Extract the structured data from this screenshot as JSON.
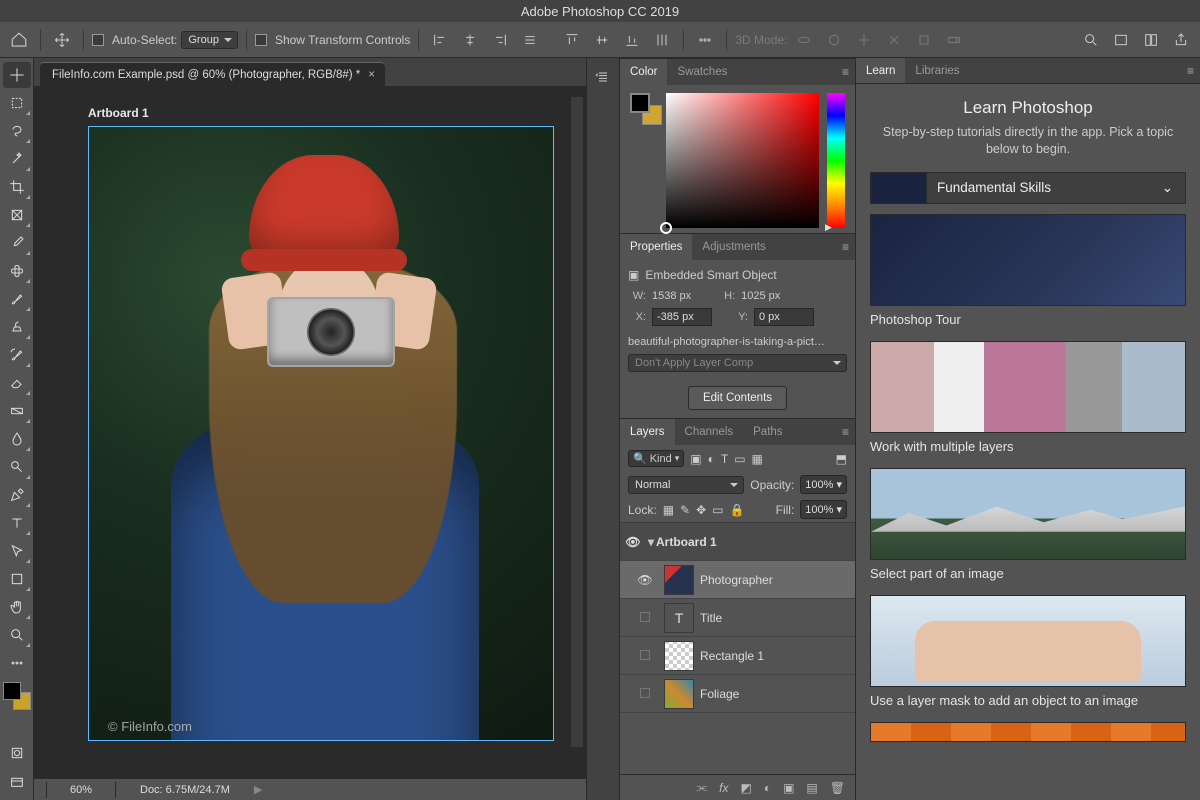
{
  "app_title": "Adobe Photoshop CC 2019",
  "options_bar": {
    "auto_select_label": "Auto-Select:",
    "auto_select_mode": "Group",
    "show_transform_label": "Show Transform Controls",
    "mode_label": "3D Mode:"
  },
  "document": {
    "tab_title": "FileInfo.com Example.psd @ 60% (Photographer, RGB/8#) *",
    "artboard_label": "Artboard 1",
    "watermark": "© FileInfo.com",
    "zoom": "60%",
    "doc_size": "Doc: 6.75M/24.7M"
  },
  "tools": [
    "move",
    "marquee",
    "lasso",
    "magic-wand",
    "crop",
    "frame",
    "eyedropper",
    "spot-heal",
    "brush",
    "clone-stamp",
    "history-brush",
    "eraser",
    "gradient",
    "blur",
    "dodge",
    "pen",
    "type",
    "path-select",
    "shape",
    "hand",
    "zoom"
  ],
  "color_panel": {
    "tabs": [
      "Color",
      "Swatches"
    ],
    "active": 0
  },
  "properties_panel": {
    "tabs": [
      "Properties",
      "Adjustments"
    ],
    "active": 0,
    "object_type": "Embedded Smart Object",
    "W": "1538 px",
    "H": "1025 px",
    "X": "-385 px",
    "Y": "0 px",
    "linked_name": "beautiful-photographer-is-taking-a-pict…",
    "layer_comp": "Don't Apply Layer Comp",
    "edit_btn": "Edit Contents"
  },
  "layers_panel": {
    "tabs": [
      "Layers",
      "Channels",
      "Paths"
    ],
    "active": 0,
    "filter_label": "Kind",
    "blend_mode": "Normal",
    "opacity_label": "Opacity:",
    "opacity": "100%",
    "lock_label": "Lock:",
    "fill_label": "Fill:",
    "fill": "100%",
    "layers": [
      {
        "name": "Artboard 1",
        "type": "artboard",
        "visible": true,
        "expanded": true
      },
      {
        "name": "Photographer",
        "type": "smartobject",
        "visible": true,
        "selected": true
      },
      {
        "name": "Title",
        "type": "text",
        "visible": false
      },
      {
        "name": "Rectangle 1",
        "type": "shape",
        "visible": false
      },
      {
        "name": "Foliage",
        "type": "image",
        "visible": false
      }
    ]
  },
  "learn_panel": {
    "tabs": [
      "Learn",
      "Libraries"
    ],
    "active": 0,
    "heading": "Learn Photoshop",
    "subheading": "Step-by-step tutorials directly in the app. Pick a topic below to begin.",
    "section": "Fundamental Skills",
    "cards": [
      {
        "title": "Photoshop Tour",
        "img": "room"
      },
      {
        "title": "Work with multiple layers",
        "img": "layers-grid"
      },
      {
        "title": "Select part of an image",
        "img": "mountain"
      },
      {
        "title": "Use a layer mask to add an object to an image",
        "img": "mask"
      }
    ]
  }
}
